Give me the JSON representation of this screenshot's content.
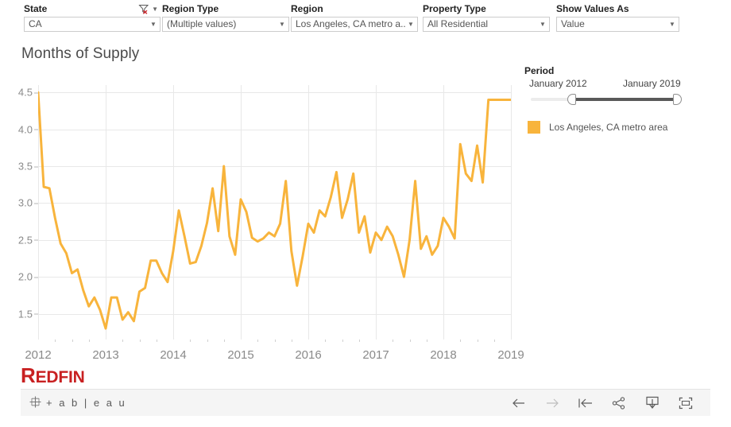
{
  "filters": [
    {
      "id": "state",
      "label": "State",
      "value": "CA",
      "has_clear_filter_icon": true
    },
    {
      "id": "regiontype",
      "label": "Region Type",
      "value": "(Multiple values)",
      "has_clear_filter_icon": false
    },
    {
      "id": "region",
      "label": "Region",
      "value": "Los Angeles, CA metro a...",
      "has_clear_filter_icon": false
    },
    {
      "id": "proptype",
      "label": "Property Type",
      "value": "All Residential",
      "has_clear_filter_icon": false
    },
    {
      "id": "showvalues",
      "label": "Show Values As",
      "value": "Value",
      "has_clear_filter_icon": false
    }
  ],
  "viz": {
    "title": "Months of Supply"
  },
  "period": {
    "title": "Period",
    "start_label": "January 2012",
    "end_label": "January 2019",
    "handle_left_pct": 28,
    "handle_right_pct": 100
  },
  "legend": {
    "items": [
      {
        "label": "Los Angeles, CA metro area",
        "color": "#f8b43c"
      }
    ]
  },
  "branding": {
    "redfin_first_letter": "R",
    "redfin_rest": "EDFIN",
    "tableau_wordmark": "+ a b | e a u"
  },
  "toolbar": {
    "buttons": [
      {
        "name": "back-button",
        "icon": "arrow-left-icon",
        "label": "←",
        "disabled": false
      },
      {
        "name": "forward-button",
        "icon": "arrow-right-icon",
        "label": "→",
        "disabled": true
      },
      {
        "name": "revert-button",
        "icon": "revert-icon",
        "label": "←",
        "disabled": false
      },
      {
        "name": "share-button",
        "icon": "share-icon",
        "label": "",
        "disabled": false
      },
      {
        "name": "download-button",
        "icon": "download-icon",
        "label": "",
        "disabled": false
      },
      {
        "name": "fullscreen-button",
        "icon": "fullscreen-icon",
        "label": "",
        "disabled": false
      }
    ]
  },
  "chart_data": {
    "type": "line",
    "title": "Months of Supply",
    "xlabel": "",
    "ylabel": "",
    "ylim": [
      1.15,
      4.6
    ],
    "yticks": [
      4.5,
      4.0,
      3.5,
      3.0,
      2.5,
      2.0,
      1.5
    ],
    "xlim": [
      2012.0,
      2019.0
    ],
    "xticks": [
      2012,
      2013,
      2014,
      2015,
      2016,
      2017,
      2018,
      2019
    ],
    "xtick_labels": [
      "2012",
      "2013",
      "2014",
      "2015",
      "2016",
      "2017",
      "2018",
      "2019"
    ],
    "grid": true,
    "legend_position": "right",
    "series": [
      {
        "name": "Los Angeles, CA metro area",
        "color": "#f8b43c",
        "x": [
          2012.0,
          2012.083,
          2012.167,
          2012.25,
          2012.333,
          2012.417,
          2012.5,
          2012.583,
          2012.667,
          2012.75,
          2012.833,
          2012.917,
          2013.0,
          2013.083,
          2013.167,
          2013.25,
          2013.333,
          2013.417,
          2013.5,
          2013.583,
          2013.667,
          2013.75,
          2013.833,
          2013.917,
          2014.0,
          2014.083,
          2014.167,
          2014.25,
          2014.333,
          2014.417,
          2014.5,
          2014.583,
          2014.667,
          2014.75,
          2014.833,
          2014.917,
          2015.0,
          2015.083,
          2015.167,
          2015.25,
          2015.333,
          2015.417,
          2015.5,
          2015.583,
          2015.667,
          2015.75,
          2015.833,
          2015.917,
          2016.0,
          2016.083,
          2016.167,
          2016.25,
          2016.333,
          2016.417,
          2016.5,
          2016.583,
          2016.667,
          2016.75,
          2016.833,
          2016.917,
          2017.0,
          2017.083,
          2017.167,
          2017.25,
          2017.333,
          2017.417,
          2017.5,
          2017.583,
          2017.667,
          2017.75,
          2017.833,
          2017.917,
          2018.0,
          2018.083,
          2018.167,
          2018.25,
          2018.333,
          2018.417,
          2018.5,
          2018.583,
          2018.667,
          2018.75,
          2018.833,
          2018.917,
          2019.0
        ],
        "y": [
          4.5,
          3.22,
          3.2,
          2.8,
          2.45,
          2.32,
          2.05,
          2.1,
          1.82,
          1.6,
          1.72,
          1.55,
          1.3,
          1.72,
          1.72,
          1.42,
          1.52,
          1.4,
          1.8,
          1.85,
          2.22,
          2.22,
          2.05,
          1.93,
          2.35,
          2.9,
          2.55,
          2.18,
          2.2,
          2.42,
          2.73,
          3.2,
          2.62,
          3.5,
          2.55,
          2.3,
          3.05,
          2.88,
          2.53,
          2.48,
          2.52,
          2.6,
          2.55,
          2.72,
          3.3,
          2.35,
          1.88,
          2.28,
          2.72,
          2.6,
          2.9,
          2.82,
          3.08,
          3.42,
          2.8,
          3.05,
          3.4,
          2.6,
          2.82,
          2.33,
          2.6,
          2.5,
          2.68,
          2.55,
          2.3,
          2.0,
          2.5,
          3.3,
          2.38,
          2.55,
          2.3,
          2.42,
          2.8,
          2.68,
          2.52,
          3.8,
          3.4,
          3.3,
          3.78,
          3.28,
          4.4,
          4.4,
          4.4,
          4.4,
          4.4
        ]
      }
    ]
  }
}
